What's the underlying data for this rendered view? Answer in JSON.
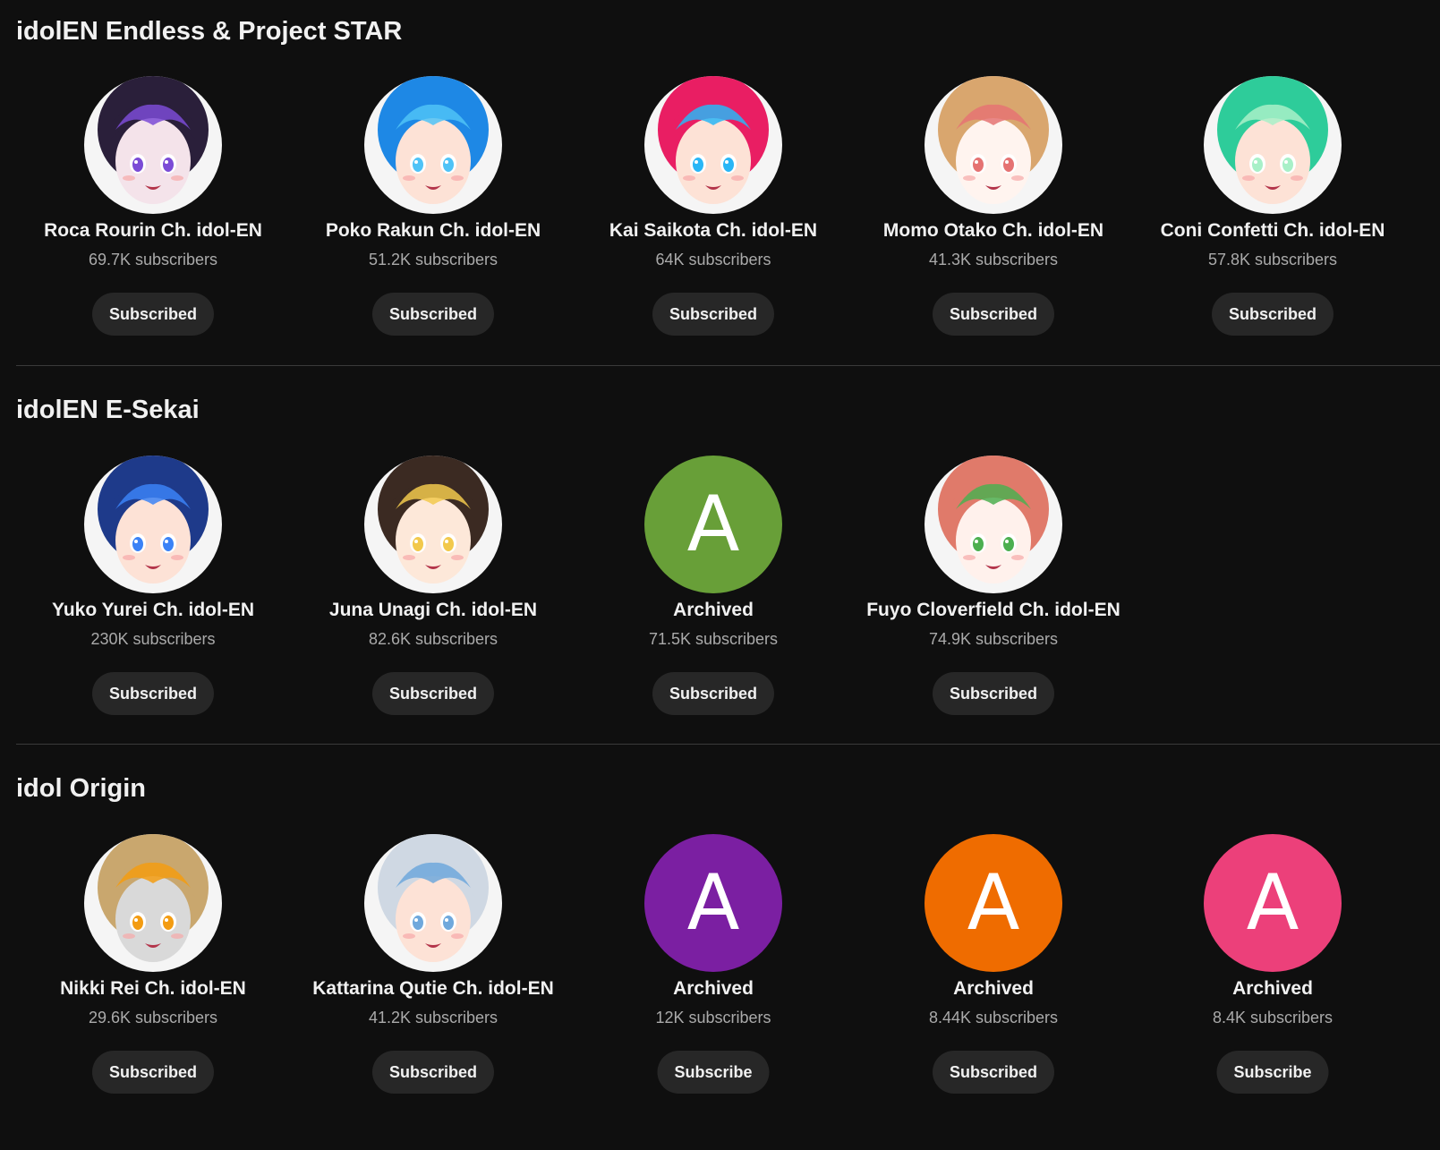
{
  "sections": [
    {
      "title": "idolEN Endless & Project STAR",
      "channels": [
        {
          "name": "Roca Rourin Ch. idol-EN",
          "subs": "69.7K subscribers",
          "button": "Subscribed",
          "avatar": "roca-rourin-avatar",
          "colors": [
            "#2a1f3a",
            "#7b4bd6",
            "#f4e3ea"
          ]
        },
        {
          "name": "Poko Rakun Ch. idol-EN",
          "subs": "51.2K subscribers",
          "button": "Subscribed",
          "avatar": "poko-rakun-avatar",
          "colors": [
            "#1e88e5",
            "#4fc3f7",
            "#fde2d6"
          ]
        },
        {
          "name": "Kai Saikota Ch. idol-EN",
          "subs": "64K subscribers",
          "button": "Subscribed",
          "avatar": "kai-saikota-avatar",
          "colors": [
            "#e91e63",
            "#29b6f6",
            "#fde2d6"
          ]
        },
        {
          "name": "Momo Otako Ch. idol-EN",
          "subs": "41.3K subscribers",
          "button": "Subscribed",
          "avatar": "momo-otako-avatar",
          "colors": [
            "#d9a66e",
            "#e57373",
            "#fff4ef"
          ]
        },
        {
          "name": "Coni Confetti Ch. idol-EN",
          "subs": "57.8K subscribers",
          "button": "Subscribed",
          "avatar": "coni-confetti-avatar",
          "colors": [
            "#2ecc9a",
            "#a8f0c8",
            "#fde2d6"
          ]
        }
      ]
    },
    {
      "title": "idolEN E-Sekai",
      "channels": [
        {
          "name": "Yuko Yurei Ch. idol-EN",
          "subs": "230K subscribers",
          "button": "Subscribed",
          "avatar": "yuko-yurei-avatar",
          "colors": [
            "#1e3a8a",
            "#3b82f6",
            "#fde2d6"
          ]
        },
        {
          "name": "Juna Unagi Ch. idol-EN",
          "subs": "82.6K subscribers",
          "button": "Subscribed",
          "avatar": "juna-unagi-avatar",
          "colors": [
            "#3b2a22",
            "#f2c94c",
            "#fde8d9"
          ]
        },
        {
          "name": "Archived",
          "subs": "71.5K subscribers",
          "button": "Subscribed",
          "avatar": "letter-a-avatar",
          "letter": "A",
          "colors": [
            "#689f38"
          ]
        },
        {
          "name": "Fuyo Cloverfield Ch. idol-EN",
          "subs": "74.9K subscribers",
          "button": "Subscribed",
          "avatar": "fuyo-cloverfield-avatar",
          "colors": [
            "#e07a6a",
            "#4caf50",
            "#fff1ec"
          ]
        }
      ]
    },
    {
      "title": "idol Origin",
      "channels": [
        {
          "name": "Nikki Rei Ch. idol-EN",
          "subs": "29.6K subscribers",
          "button": "Subscribed",
          "avatar": "nikki-rei-avatar",
          "colors": [
            "#c9a76e",
            "#f39c12",
            "#d9d9d9"
          ]
        },
        {
          "name": "Kattarina Qutie Ch. idol-EN",
          "subs": "41.2K subscribers",
          "button": "Subscribed",
          "avatar": "kattarina-qutie-avatar",
          "colors": [
            "#cfd8e3",
            "#6fa8dc",
            "#fde2d6"
          ]
        },
        {
          "name": "Archived",
          "subs": "12K subscribers",
          "button": "Subscribe",
          "avatar": "letter-a-avatar",
          "letter": "A",
          "colors": [
            "#7b1fa2"
          ]
        },
        {
          "name": "Archived",
          "subs": "8.44K subscribers",
          "button": "Subscribed",
          "avatar": "letter-a-avatar",
          "letter": "A",
          "colors": [
            "#ef6c00"
          ]
        },
        {
          "name": "Archived",
          "subs": "8.4K subscribers",
          "button": "Subscribe",
          "avatar": "letter-a-avatar",
          "letter": "A",
          "colors": [
            "#ec407a"
          ]
        }
      ]
    }
  ]
}
